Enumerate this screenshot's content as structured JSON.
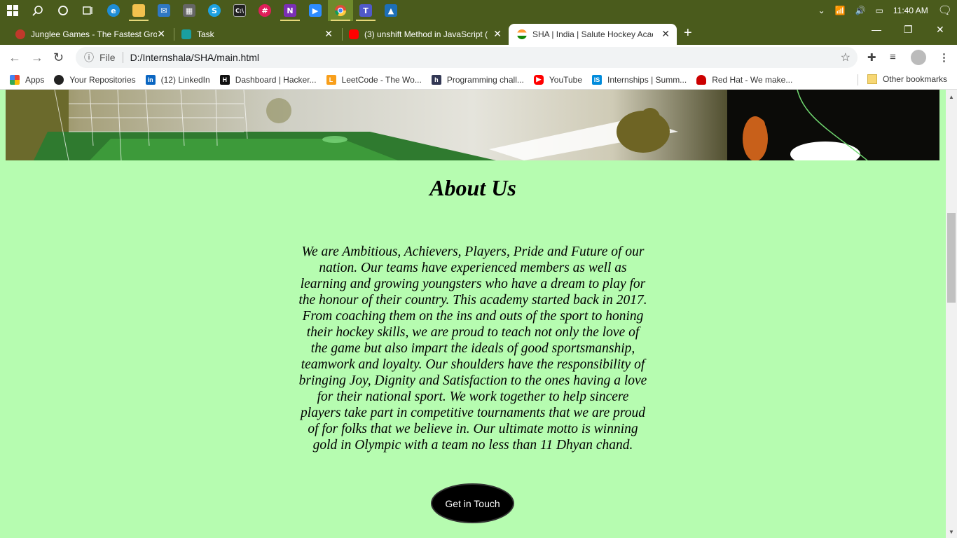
{
  "taskbar": {
    "icons": [
      {
        "name": "windows-start-icon",
        "color": "#ffffff"
      },
      {
        "name": "search-icon",
        "color": "#ffffff"
      },
      {
        "name": "cortana-icon",
        "color": "#ffffff"
      },
      {
        "name": "task-view-icon",
        "color": "#ffffff"
      },
      {
        "name": "edge-icon",
        "color": "#1e8dd6"
      },
      {
        "name": "file-explorer-icon",
        "color": "#f2c14e"
      },
      {
        "name": "mail-icon",
        "color": "#2f78c4"
      },
      {
        "name": "store-icon",
        "color": "#666666"
      },
      {
        "name": "skype-icon",
        "color": "#1da1e2"
      },
      {
        "name": "terminal-icon",
        "color": "#222222"
      },
      {
        "name": "slack-icon",
        "color": "#e01e5a"
      },
      {
        "name": "onenote-icon",
        "color": "#7b2fb5"
      },
      {
        "name": "zoom-icon",
        "color": "#2d8cff"
      },
      {
        "name": "chrome-icon",
        "color": "#dd4b39"
      },
      {
        "name": "teams-icon",
        "color": "#5059c9"
      },
      {
        "name": "photos-icon",
        "color": "#1d6fb8"
      }
    ],
    "time": "11:40 AM"
  },
  "tabs": [
    {
      "title": "Junglee Games - The Fastest Gro",
      "favicon_color": "#c0392b"
    },
    {
      "title": "Task",
      "favicon_color": "#1a9fa0"
    },
    {
      "title": "(3) unshift Method in JavaScript (",
      "favicon_color": "#ff0000"
    },
    {
      "title": "SHA | India | Salute Hockey Acad",
      "favicon_color": "#ff9933"
    }
  ],
  "address": {
    "file_label": "File",
    "url": "D:/Internshala/SHA/main.html"
  },
  "bookmarks": [
    {
      "label": "Apps",
      "icon": "apps-grid-icon",
      "color": "#ea4335"
    },
    {
      "label": "Your Repositories",
      "icon": "github-icon",
      "color": "#222222"
    },
    {
      "label": "(12) LinkedIn",
      "icon": "linkedin-icon",
      "color": "#0a66c2"
    },
    {
      "label": "Dashboard | Hacker...",
      "icon": "hackerrank-icon",
      "color": "#111111"
    },
    {
      "label": "LeetCode - The Wo...",
      "icon": "leetcode-icon",
      "color": "#f89f1b"
    },
    {
      "label": "Programming chall...",
      "icon": "hackerearth-icon",
      "color": "#323754"
    },
    {
      "label": "YouTube",
      "icon": "youtube-icon",
      "color": "#ff0000"
    },
    {
      "label": "Internships | Summ...",
      "icon": "internshala-icon",
      "color": "#008bdc"
    },
    {
      "label": "Red Hat - We make...",
      "icon": "redhat-icon",
      "color": "#cc0000"
    }
  ],
  "other_bookmarks": "Other bookmarks",
  "page": {
    "heading": "About Us",
    "paragraph": "We are Ambitious, Achievers, Players, Pride and Future of our nation. Our teams have experienced members as well as learning and growing youngsters who have a dream to play for the honour of their country. This academy started back in 2017. From coaching them on the ins and outs of the sport to honing their hockey skills, we are proud to teach not only the love of the game but also impart the ideals of good sportsmanship, teamwork and loyalty. Our shoulders have the responsibility of bringing Joy, Dignity and Satisfaction to the ones having a love for their national sport. We work together to help sincere players take part in competitive tournaments that we are proud of for folks that we believe in. Our ultimate motto is winning gold in Olympic with a team no less than 11 Dhyan chand.",
    "cta_label": "Get in Touch",
    "background_color": "#b6fcb0"
  }
}
